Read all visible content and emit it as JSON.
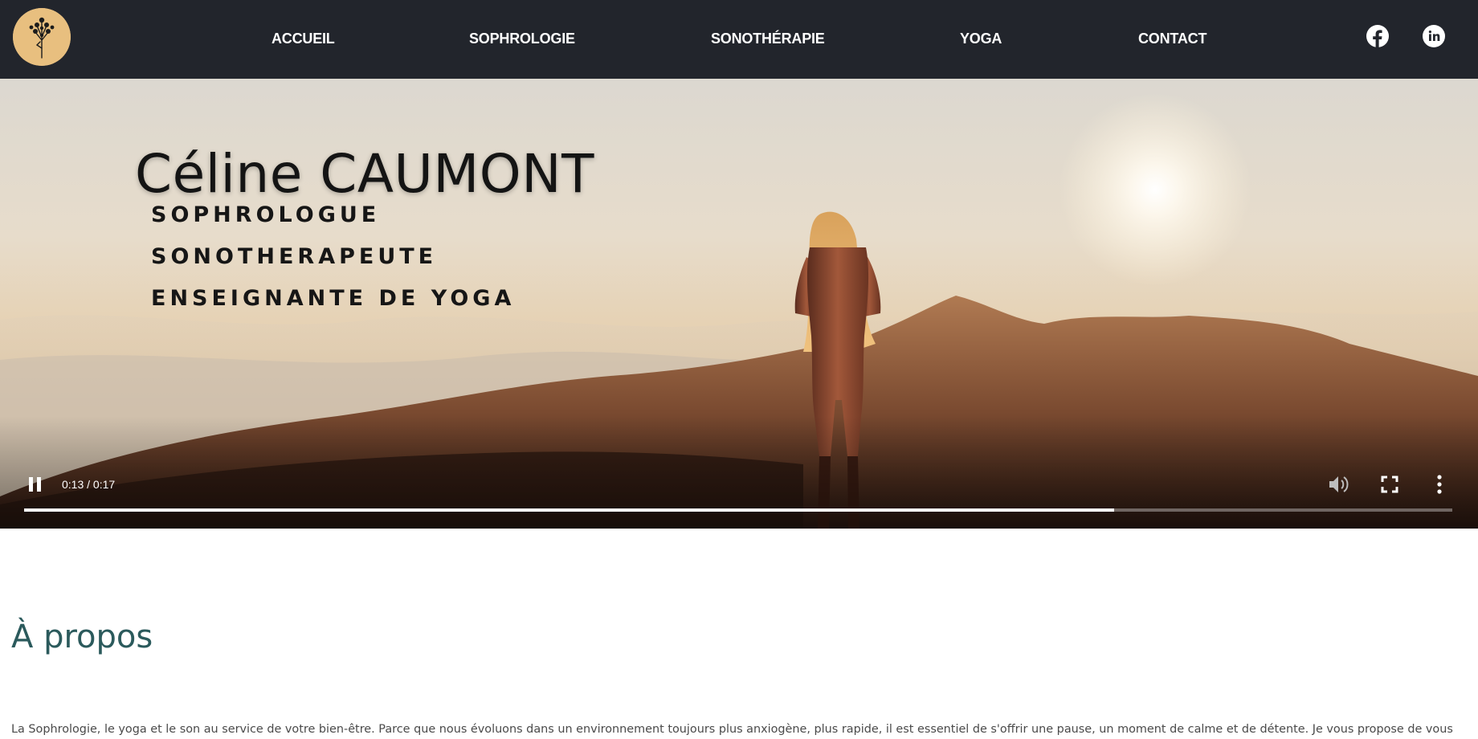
{
  "header": {
    "logo_name": "tree-yoga-logo",
    "nav": [
      {
        "label": "ACCUEIL"
      },
      {
        "label": "SOPHROLOGIE"
      },
      {
        "label": "SONOTHÉRAPIE"
      },
      {
        "label": "YOGA"
      },
      {
        "label": "CONTACT"
      }
    ],
    "social": [
      {
        "icon": "facebook-icon"
      },
      {
        "icon": "linkedin-icon"
      }
    ]
  },
  "hero": {
    "title": "Céline CAUMONT",
    "roles": [
      "SOPHROLOGUE",
      "SONOTHERAPEUTE",
      "ENSEIGNANTE DE YOGA"
    ]
  },
  "video": {
    "time": "0:13 / 0:17",
    "progress_fraction": 0.763,
    "playing": true
  },
  "about": {
    "title": "À propos",
    "text": "La Sophrologie, le yoga et le son au service de votre bien-être. Parce que nous évoluons dans un environnement toujours plus anxiogène, plus rapide, il est essentiel de s'offrir une pause, un moment de calme et de détente. Je vous propose de vous"
  },
  "colors": {
    "header_bg": "#22252c",
    "logo_bg": "#e8bf7f",
    "about_title": "#2b5a5c"
  }
}
